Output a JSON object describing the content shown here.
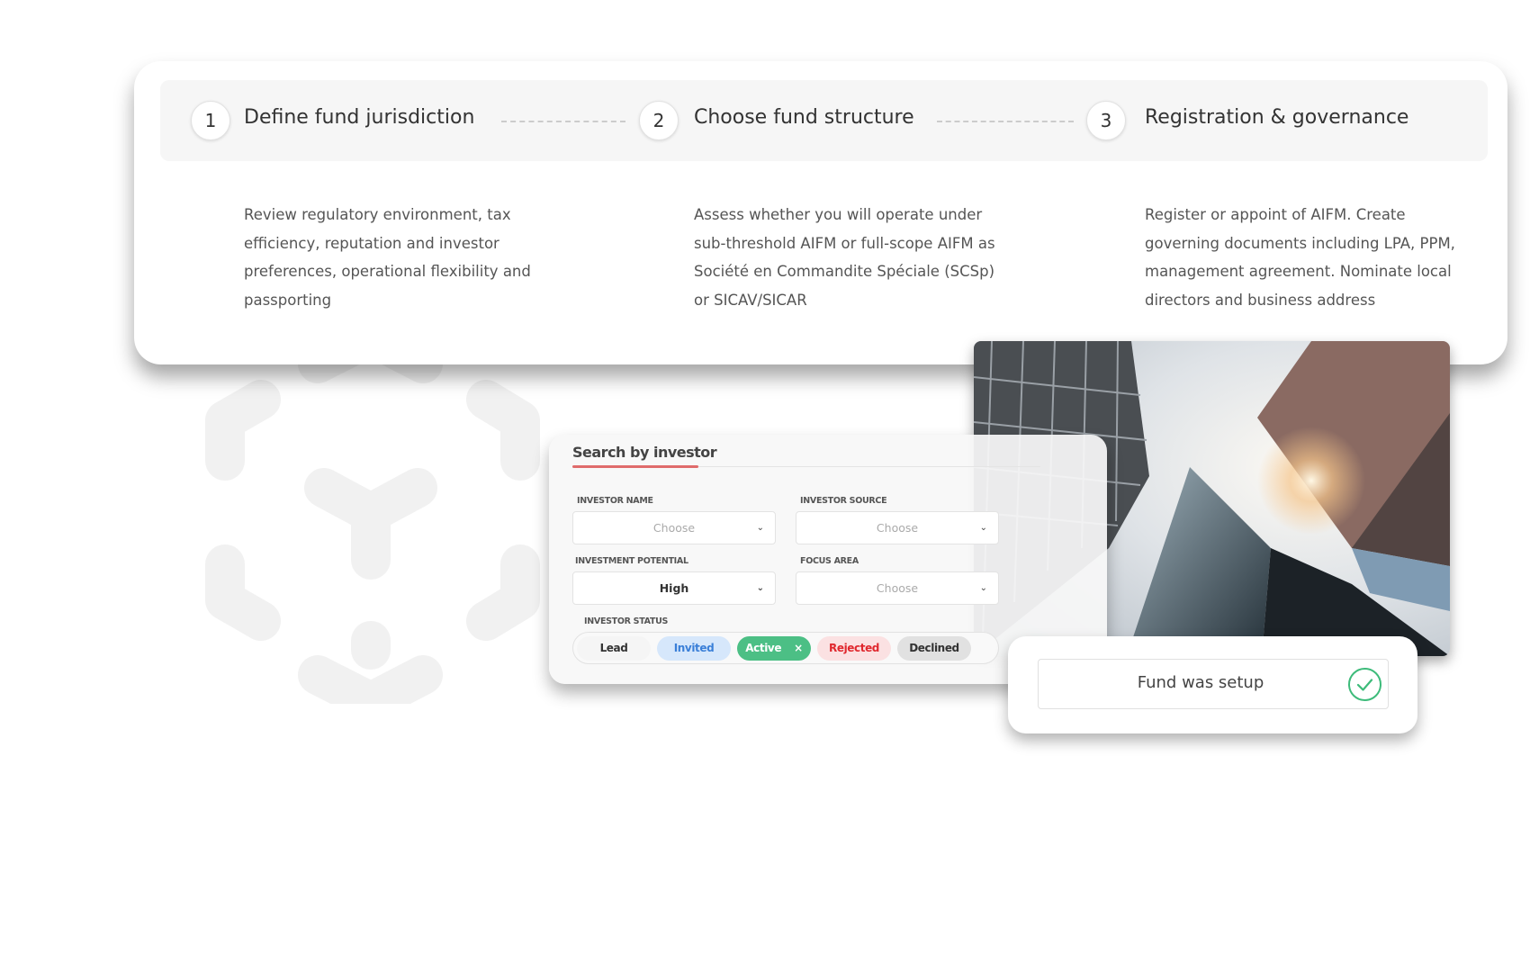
{
  "steps": [
    {
      "number": "1",
      "title": "Define fund jurisdiction",
      "description": "Review regulatory environment, tax efficiency, reputation and investor preferences, operational flexibility and passporting"
    },
    {
      "number": "2",
      "title": "Choose fund structure",
      "description": "Assess whether you will operate under sub-threshold AIFM or full-scope AIFM as Société en Commandite Spéciale (SCSp) or SICAV/SICAR"
    },
    {
      "number": "3",
      "title": "Registration & governance",
      "description": "Register or appoint of AIFM. Create governing documents including LPA, PPM, management agreement. Nominate local directors and business address"
    }
  ],
  "search": {
    "title": "Search by investor",
    "accent": "#e06b6b",
    "fields": [
      {
        "label": "INVESTOR NAME",
        "value": "Choose"
      },
      {
        "label": "INVESTOR SOURCE",
        "value": "Choose"
      },
      {
        "label": "INVESTMENT POTENTIAL",
        "value": "High"
      },
      {
        "label": "FOCUS AREA",
        "value": "Choose"
      }
    ],
    "status_label": "INVESTOR STATUS",
    "statuses": [
      {
        "label": "Lead",
        "color": "#333333",
        "bg": "#f5f5f5"
      },
      {
        "label": "Invited",
        "color": "#3a7fd8",
        "bg": "#d6e7fb"
      },
      {
        "label": "Active",
        "color": "#ffffff",
        "bg": "#4cbf85",
        "remove": "×"
      },
      {
        "label": "Rejected",
        "color": "#e0282e",
        "bg": "#fbe1e2"
      },
      {
        "label": "Declined",
        "color": "#333333",
        "bg": "#e1e1e1"
      }
    ]
  },
  "notification": {
    "text": "Fund was setup",
    "icon": "check-circle-icon",
    "color": "#3dbb7a"
  }
}
